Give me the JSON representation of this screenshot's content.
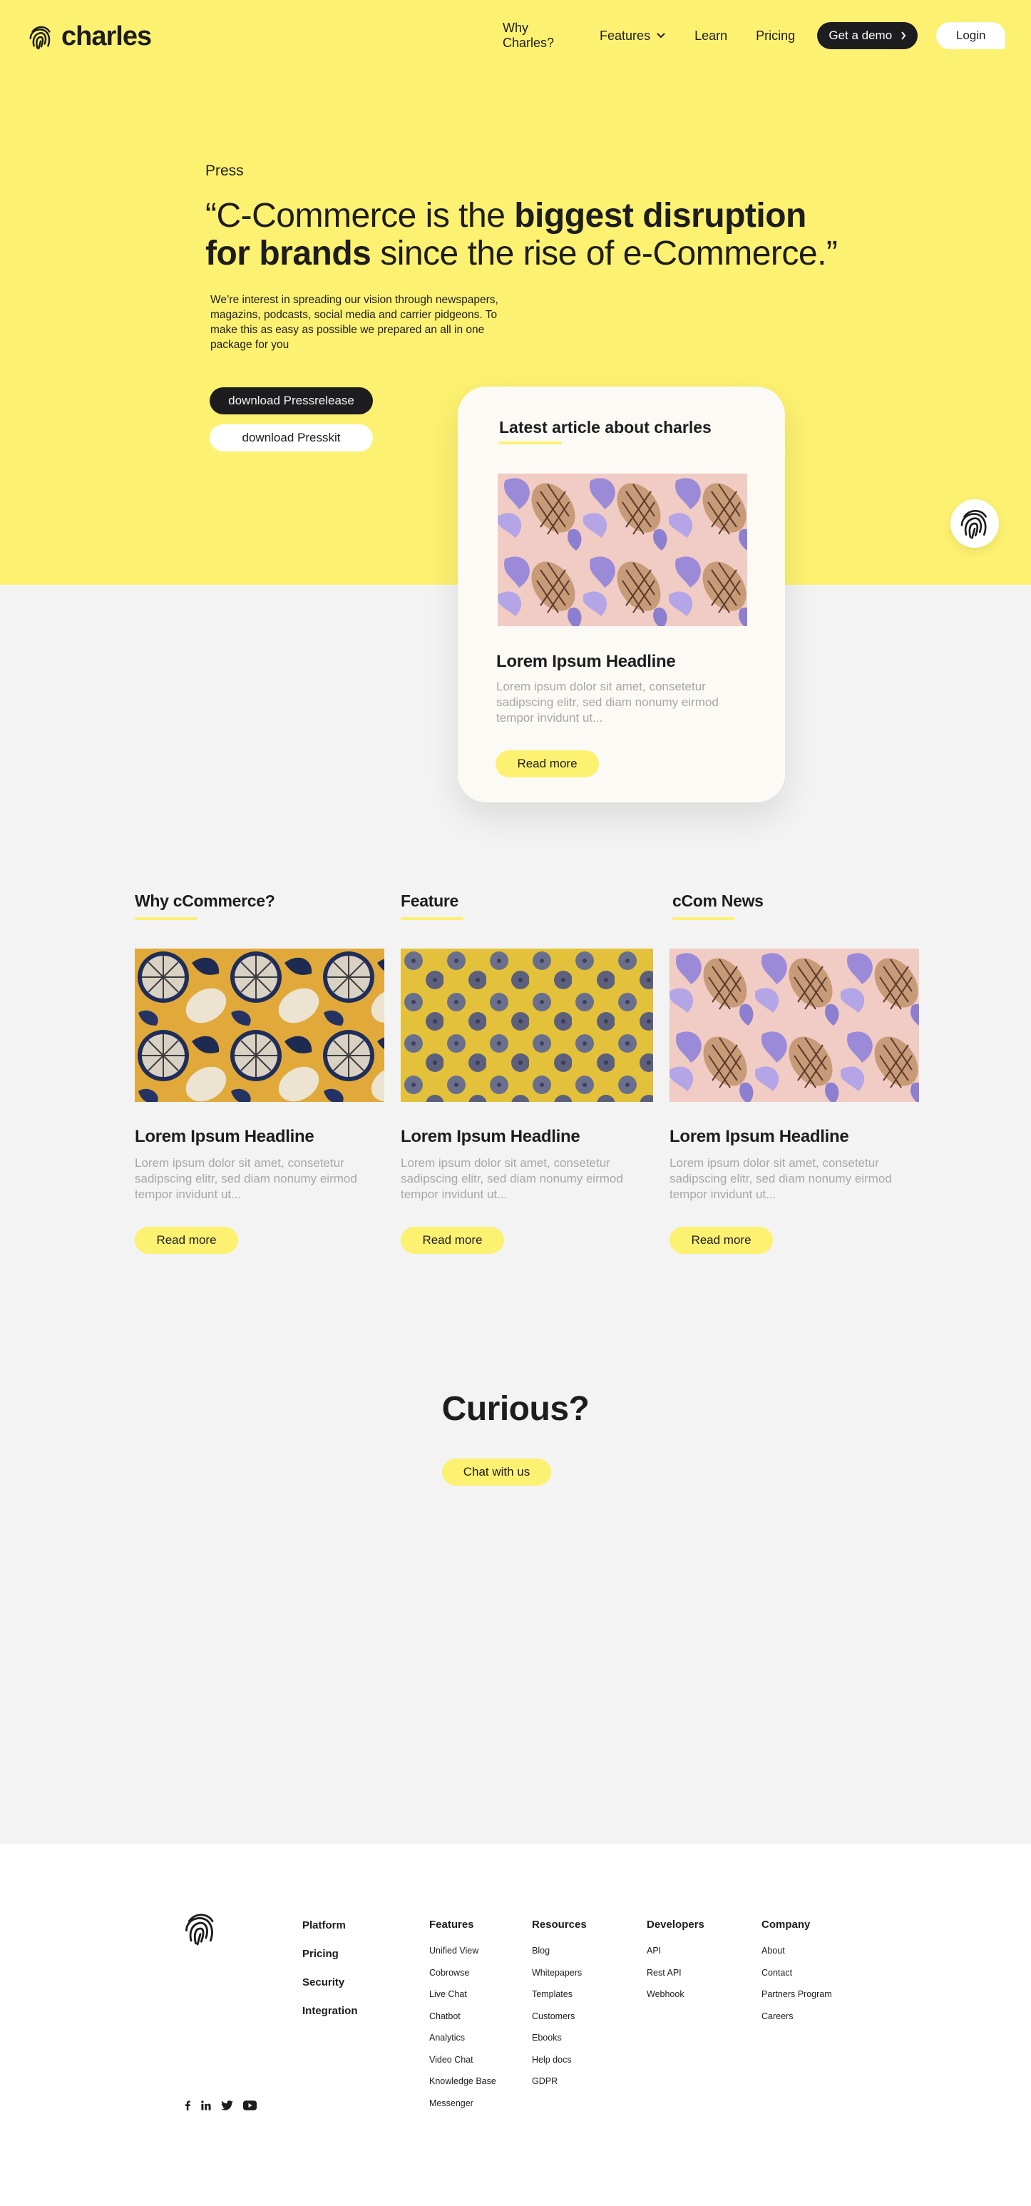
{
  "nav": {
    "brand": "charles",
    "links": [
      "Why Charles?",
      "Features",
      "Learn",
      "Pricing"
    ],
    "demo_label": "Get a demo",
    "login_label": "Login"
  },
  "hero": {
    "eyebrow": "Press",
    "title_open": "“C-Commerce is the ",
    "title_bold_1": "biggest disruption",
    "title_bold_2": "for brands",
    "title_close": " since the rise of e-Commerce.”",
    "description": "We’re interest in spreading our vision through newspapers, magazins, podcasts, social media and carrier pidgeons. To make this as easy as possible we prepared an all in one package for you",
    "btn_pressrelease": "download Pressrelease",
    "btn_presskit": "download Presskit"
  },
  "featured": {
    "heading": "Latest article about charles",
    "headline": "Lorem Ipsum Headline",
    "excerpt": "Lorem ipsum dolor sit amet, consetetur sadipscing elitr, sed diam nonumy eirmod tempor invidunt ut...",
    "cta": "Read more",
    "image": "pineapple-pattern"
  },
  "columns": [
    {
      "heading": "Why cCommerce?",
      "headline": "Lorem Ipsum Headline",
      "excerpt": "Lorem ipsum dolor sit amet, consetetur sadipscing elitr, sed diam nonumy eirmod tempor invidunt ut...",
      "cta": "Read more",
      "image": "citrus-pattern"
    },
    {
      "heading": "Feature",
      "headline": "Lorem Ipsum Headline",
      "excerpt": "Lorem ipsum dolor sit amet, consetetur sadipscing elitr, sed diam nonumy eirmod tempor invidunt ut...",
      "cta": "Read more",
      "image": "blueberry-pattern"
    },
    {
      "heading": "cCom News",
      "headline": "Lorem Ipsum Headline",
      "excerpt": "Lorem ipsum dolor sit amet, consetetur sadipscing elitr, sed diam nonumy eirmod tempor invidunt ut...",
      "cta": "Read more",
      "image": "pineapple-pattern"
    }
  ],
  "curious": {
    "title": "Curious?",
    "cta": "Chat with us"
  },
  "footer": {
    "main_links": [
      "Platform",
      "Pricing",
      "Security",
      "Integration"
    ],
    "features": {
      "heading": "Features",
      "items": [
        "Unified View",
        "Cobrowse",
        "Live Chat",
        "Chatbot",
        "Analytics",
        "Video Chat",
        "Knowledge Base",
        "Messenger"
      ]
    },
    "resources": {
      "heading": "Resources",
      "items": [
        "Blog",
        "Whitepapers",
        "Templates",
        "Customers",
        "Ebooks",
        "Help docs",
        "GDPR"
      ]
    },
    "developers": {
      "heading": "Developers",
      "items": [
        "API",
        "Rest API",
        "Webhook"
      ]
    },
    "company": {
      "heading": "Company",
      "items": [
        "About",
        "Contact",
        "Partners Program",
        "Careers"
      ]
    },
    "social": [
      "facebook-icon",
      "linkedin-icon",
      "twitter-icon",
      "youtube-icon"
    ]
  },
  "colors": {
    "accent": "#fdf171",
    "dark": "#1d1d1f",
    "muted": "#a7a7a7",
    "section": "#f3f3f3"
  }
}
